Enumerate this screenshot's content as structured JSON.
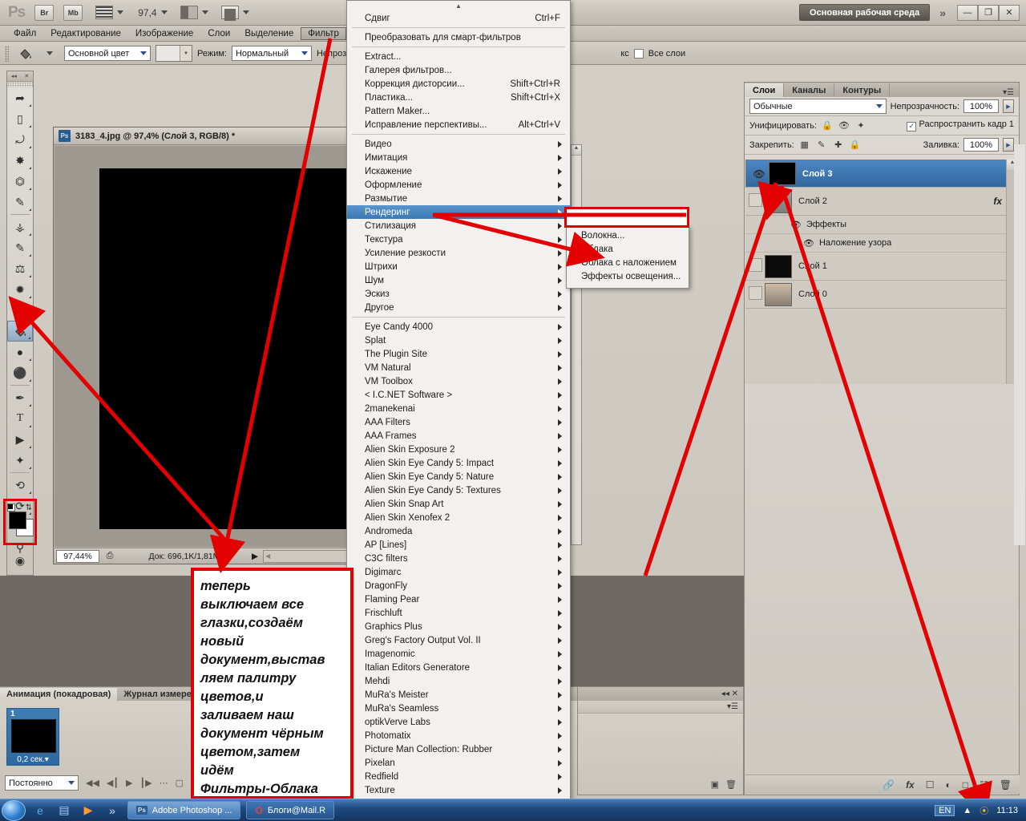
{
  "app": {
    "logo": "Ps",
    "zoom_value": "97,4",
    "buttons": {
      "bridge": "Br",
      "minibridge": "Mb"
    },
    "workspace": "Основная рабочая среда",
    "chevrons": "»",
    "window_buttons": [
      "—",
      "❐",
      "✕"
    ]
  },
  "menubar": {
    "items": [
      {
        "label": "Файл",
        "active": false
      },
      {
        "label": "Редактирование",
        "active": false
      },
      {
        "label": "Изображение",
        "active": false
      },
      {
        "label": "Слои",
        "active": false
      },
      {
        "label": "Выделение",
        "active": false
      },
      {
        "label": "Фильтр",
        "active": true
      }
    ]
  },
  "options_bar": {
    "fill_source_label": "Основной цвет",
    "mode_label": "Режим:",
    "mode_value": "Нормальный",
    "opacity_label": "Непрозрачность",
    "tolerance_units": "кс",
    "all_layers_label": "Все слои"
  },
  "toolbox": {
    "tools": [
      "move-tool",
      "marquee-tool",
      "lasso-tool",
      "quick-selection-tool",
      "crop-tool",
      "eyedropper-tool",
      "healing-brush-tool",
      "brush-tool",
      "clone-stamp-tool",
      "history-brush-tool",
      "eraser-tool",
      "paint-bucket-tool",
      "gradient-tool",
      "blur-tool",
      "dodge-tool",
      "pen-tool",
      "type-tool",
      "path-selection-tool",
      "shape-tool",
      "3d-rotate-tool",
      "3d-orbit-tool",
      "hand-tool",
      "zoom-tool"
    ],
    "active_tool": "paint-bucket-tool",
    "foreground_color": "#000000",
    "background_color": "#ffffff"
  },
  "document": {
    "title": "3183_4.jpg @ 97,4% (Слой 3, RGB/8) *",
    "status_zoom": "97,44%",
    "status_doc": "Док: 696,1K/1,81M",
    "canvas_color": "#000000"
  },
  "filter_menu": {
    "scroll_up": "▲",
    "scroll_down": "▼",
    "repeat": {
      "label": "Сдвиг",
      "shortcut": "Ctrl+F"
    },
    "smart": {
      "label": "Преобразовать для смарт-фильтров"
    },
    "top_items": [
      {
        "label": "Extract...",
        "shortcut": ""
      },
      {
        "label": "Галерея фильтров...",
        "shortcut": ""
      },
      {
        "label": "Коррекция дисторсии...",
        "shortcut": "Shift+Ctrl+R"
      },
      {
        "label": "Пластика...",
        "shortcut": "Shift+Ctrl+X"
      },
      {
        "label": "Pattern Maker...",
        "shortcut": ""
      },
      {
        "label": "Исправление перспективы...",
        "shortcut": "Alt+Ctrl+V"
      }
    ],
    "categories": [
      {
        "label": "Видео",
        "highlighted": false
      },
      {
        "label": "Имитация",
        "highlighted": false
      },
      {
        "label": "Искажение",
        "highlighted": false
      },
      {
        "label": "Оформление",
        "highlighted": false
      },
      {
        "label": "Размытие",
        "highlighted": false
      },
      {
        "label": "Рендеринг",
        "highlighted": true
      },
      {
        "label": "Стилизация",
        "highlighted": false
      },
      {
        "label": "Текстура",
        "highlighted": false
      },
      {
        "label": "Усиление резкости",
        "highlighted": false
      },
      {
        "label": "Штрихи",
        "highlighted": false
      },
      {
        "label": "Шум",
        "highlighted": false
      },
      {
        "label": "Эскиз",
        "highlighted": false
      },
      {
        "label": "Другое",
        "highlighted": false
      }
    ],
    "plugins": [
      "Eye Candy 4000",
      "Splat",
      "The Plugin Site",
      "VM Natural",
      "VM Toolbox",
      "< I.C.NET Software >",
      "2manekenai",
      "AAA Filters",
      "AAA Frames",
      "Alien Skin Exposure 2",
      "Alien Skin Eye Candy 5: Impact",
      "Alien Skin Eye Candy 5: Nature",
      "Alien Skin Eye Candy 5: Textures",
      "Alien Skin Snap Art",
      "Alien Skin Xenofex 2",
      "Andromeda",
      "AP [Lines]",
      "C3C filters",
      "Digimarc",
      "DragonFly",
      "Flaming Pear",
      "Frischluft",
      "Graphics Plus",
      "Greg's Factory Output Vol. II",
      "Imagenomic",
      "Italian Editors Generatore",
      "Mehdi",
      "MuRa's Meister",
      "MuRa's Seamless",
      "optikVerve Labs",
      "Photomatix",
      "Picture Man Collection: Rubber",
      "Pixelan",
      "Redfield",
      "Texture"
    ]
  },
  "render_submenu": {
    "items": [
      {
        "label": "Волокна...",
        "highlighted": false
      },
      {
        "label": "Облака",
        "highlighted": false
      },
      {
        "label": "Облака с наложением",
        "highlighted": false
      },
      {
        "label": "Эффекты освещения...",
        "highlighted": false
      }
    ]
  },
  "layers_panel": {
    "tabs": [
      {
        "label": "Слои",
        "active": true
      },
      {
        "label": "Каналы",
        "active": false
      },
      {
        "label": "Контуры",
        "active": false
      }
    ],
    "blend_mode": "Обычные",
    "opacity_label": "Непрозрачность:",
    "opacity_value": "100%",
    "unify_label": "Унифицировать:",
    "propagate_label": "Распространить кадр 1",
    "lock_label": "Закрепить:",
    "fill_label": "Заливка:",
    "fill_value": "100%",
    "layers": [
      {
        "name": "Слой 3",
        "selected": true,
        "visible": true,
        "thumb": "#000000",
        "has_fx": false
      },
      {
        "name": "Слой 2",
        "selected": false,
        "visible": false,
        "thumb": "#8c8c8c",
        "has_fx": true
      },
      {
        "name": "Слой 1",
        "selected": false,
        "visible": false,
        "thumb": "#0a0a0a",
        "has_fx": false
      },
      {
        "name": "Слой 0",
        "selected": false,
        "visible": false,
        "thumb": "#b5a192",
        "has_fx": false
      }
    ],
    "effects_group": "Эффекты",
    "effect_item": "Наложение узора",
    "bottom_buttons": [
      "link-layers-icon",
      "layer-style-icon",
      "layer-mask-icon",
      "adjustment-layer-icon",
      "new-group-icon",
      "new-layer-icon",
      "delete-layer-icon"
    ]
  },
  "animation_panel": {
    "tabs": [
      {
        "label": "Анимация (покадровая)",
        "active": true
      },
      {
        "label": "Журнал измерений",
        "active": false
      }
    ],
    "frame_number": "1",
    "frame_delay": "0,2 сек.",
    "loop_value": "Постоянно"
  },
  "annotation": {
    "lines": [
      "теперь",
      "выключаем все",
      "глазки,создаём",
      "новый",
      "документ,выстав",
      "ляем палитру",
      "цветов,и",
      "заливаем наш",
      "документ чёрным",
      "цветом,затем",
      "идём",
      "Фильтры-Облака"
    ],
    "border_color": "#e20000"
  },
  "taskbar": {
    "tasks": [
      {
        "label": "Adobe Photoshop ...",
        "icon": "ps-icon"
      },
      {
        "label": "Блоги@Mail.R",
        "icon": "opera-icon"
      }
    ],
    "language": "EN",
    "clock": "11:13"
  }
}
